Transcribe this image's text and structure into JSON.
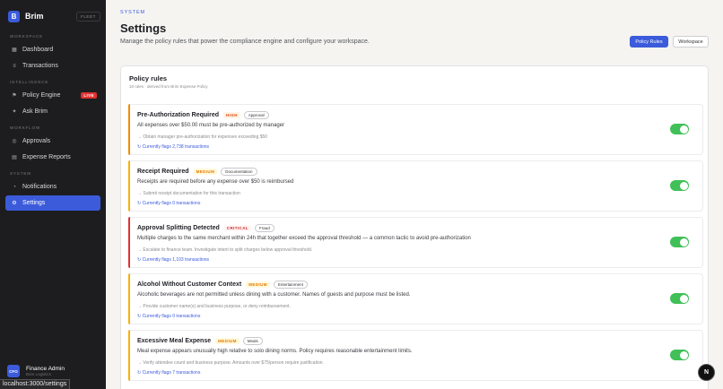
{
  "brand": {
    "logo_letter": "B",
    "name": "Brim",
    "badge": "FLEET"
  },
  "sidebar": {
    "sections": [
      {
        "label": "WORKSPACE",
        "items": [
          {
            "label": "Dashboard",
            "icon": "grid-icon"
          },
          {
            "label": "Transactions",
            "icon": "list-icon"
          }
        ]
      },
      {
        "label": "INTELLIGENCE",
        "items": [
          {
            "label": "Policy Engine",
            "icon": "flag-icon",
            "badge": "LIVE"
          },
          {
            "label": "Ask Brim",
            "icon": "sparkle-icon"
          }
        ]
      },
      {
        "label": "WORKFLOW",
        "items": [
          {
            "label": "Approvals",
            "icon": "check-icon"
          },
          {
            "label": "Expense Reports",
            "icon": "report-icon"
          }
        ]
      },
      {
        "label": "SYSTEM",
        "items": [
          {
            "label": "Notifications",
            "icon": "bell-icon"
          },
          {
            "label": "Settings",
            "icon": "gear-icon",
            "active": true
          }
        ]
      }
    ],
    "user": {
      "initials": "CFO",
      "name": "Finance Admin",
      "sub": "Brim Logistics"
    }
  },
  "url_tooltip": "localhost:3000/settings",
  "header": {
    "kicker": "SYSTEM",
    "title": "Settings",
    "description": "Manage the policy rules that power the compliance engine and configure your workspace.",
    "tabs": [
      "Policy Rules",
      "Workspace"
    ]
  },
  "panel": {
    "title": "Policy rules",
    "subtitle": "10 rules · derived from Brim Expense Policy",
    "rules": [
      {
        "name": "Pre-Authorization Required",
        "severity": "HIGH",
        "category": "Approval",
        "description": "All expenses over $50.00 must be pre-authorized by manager",
        "action": "→ Obtain manager pre-authorization for expenses exceeding $50",
        "flags": "↻ Currently flags 2,738 transactions",
        "enabled": true,
        "accent": "#f08c00"
      },
      {
        "name": "Receipt Required",
        "severity": "MEDIUM",
        "category": "Documentation",
        "description": "Receipts are required before any expense over $50 is reimbursed",
        "action": "→ Submit receipt documentation for this transaction",
        "flags": "↻ Currently flags 0 transactions",
        "enabled": true,
        "accent": "#fab005"
      },
      {
        "name": "Approval Splitting Detected",
        "severity": "CRITICAL",
        "category": "Fraud",
        "description": "Multiple charges to the same merchant within 24h that together exceed the approval threshold — a common tactic to avoid pre-authorization",
        "action": "→ Escalate to finance team. Investigate intent to split charges below approval threshold.",
        "flags": "↻ Currently flags 1,103 transactions",
        "enabled": true,
        "accent": "#e03131"
      },
      {
        "name": "Alcohol Without Customer Context",
        "severity": "MEDIUM",
        "category": "Entertainment",
        "description": "Alcoholic beverages are not permitted unless dining with a customer. Names of guests and purpose must be listed.",
        "action": "→ Provide customer name(s) and business purpose, or deny reimbursement.",
        "flags": "↻ Currently flags 0 transactions",
        "enabled": true,
        "accent": "#fab005"
      },
      {
        "name": "Excessive Meal Expense",
        "severity": "MEDIUM",
        "category": "Meals",
        "description": "Meal expense appears unusually high relative to solo dining norms. Policy requires reasonable entertainment limits.",
        "action": "→ Verify attendee count and business purpose. Amounts over $75/person require justification.",
        "flags": "↻ Currently flags 7 transactions",
        "enabled": true,
        "accent": "#fab005"
      }
    ]
  },
  "fab_label": "N",
  "colors": {
    "accent": "#3b5bdb",
    "toggle_on": "#40c057",
    "sidebar_bg": "#1d1d1f"
  }
}
